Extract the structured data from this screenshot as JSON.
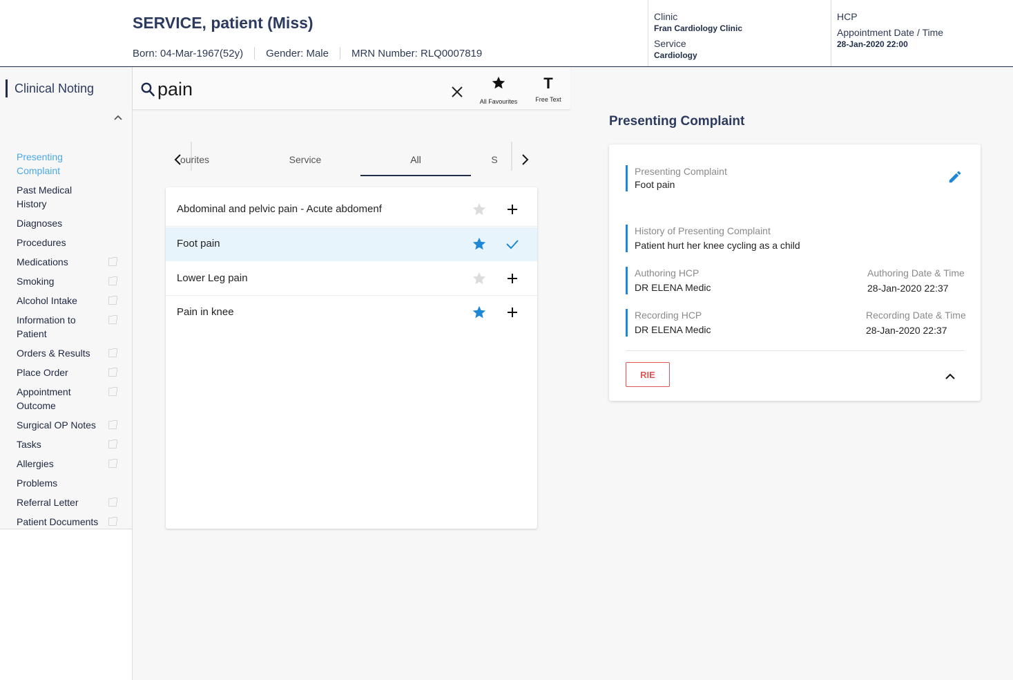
{
  "header": {
    "patient_name": "SERVICE, patient (Miss)",
    "born": "Born: 04-Mar-1967(52y)",
    "gender": "Gender: Male",
    "mrn": "MRN Number: RLQ0007819",
    "clinic_label": "Clinic",
    "clinic_value": "Fran Cardiology Clinic",
    "service_label": "Service",
    "service_value": "Cardiology",
    "hcp_label": "HCP",
    "appt_label": "Appointment Date / Time",
    "appt_value": "28-Jan-2020 22:00"
  },
  "sidebar": {
    "title": "Clinical Noting",
    "items": [
      {
        "label": "Presenting Complaint",
        "ext": false,
        "active": true
      },
      {
        "label": "Past Medical History",
        "ext": false
      },
      {
        "label": "Diagnoses",
        "ext": false
      },
      {
        "label": "Procedures",
        "ext": false
      },
      {
        "label": "Medications",
        "ext": true
      },
      {
        "label": "Smoking",
        "ext": true
      },
      {
        "label": "Alcohol Intake",
        "ext": true
      },
      {
        "label": "Information to Patient",
        "ext": true
      },
      {
        "label": "Orders & Results",
        "ext": true
      },
      {
        "label": "Place Order",
        "ext": true
      },
      {
        "label": "Appointment Outcome",
        "ext": true
      },
      {
        "label": "Surgical OP Notes",
        "ext": true
      },
      {
        "label": "Tasks",
        "ext": true
      },
      {
        "label": "Allergies",
        "ext": true
      },
      {
        "label": "Problems",
        "ext": false
      },
      {
        "label": "Referral Letter",
        "ext": true
      },
      {
        "label": "Patient Documents",
        "ext": true
      }
    ]
  },
  "search": {
    "value": "pain",
    "all_favourites_label": "All Favourites",
    "free_text_label": "Free Text",
    "free_text_glyph": "T"
  },
  "tabs": {
    "items": [
      "ourites",
      "Service",
      "All",
      "S"
    ],
    "active": "All"
  },
  "results": [
    {
      "label": "Abdominal and pelvic pain - Acute abdomenf",
      "favourite": false,
      "selected": false
    },
    {
      "label": "Foot pain",
      "favourite": true,
      "selected": true
    },
    {
      "label": "Lower Leg pain",
      "favourite": false,
      "selected": false
    },
    {
      "label": "Pain in knee",
      "favourite": true,
      "selected": false
    }
  ],
  "panel": {
    "title": "Presenting Complaint",
    "presenting_label": "Presenting Complaint",
    "presenting_value": "Foot pain",
    "history_label": "History of Presenting Complaint",
    "history_value": "Patient hurt her knee cycling as a child",
    "authoring_hcp_label": "Authoring HCP",
    "authoring_hcp_value": "DR ELENA Medic",
    "authoring_dt_label": "Authoring Date & Time",
    "authoring_dt_value": "28-Jan-2020 22:37",
    "recording_hcp_label": "Recording HCP",
    "recording_hcp_value": "DR ELENA Medic",
    "recording_dt_label": "Recording Date & Time",
    "recording_dt_value": "28-Jan-2020 22:37",
    "rie_label": "RIE"
  },
  "colors": {
    "accent_blue": "#1e88d6",
    "active_link": "#4aa8e8",
    "navy": "#2b3a5e",
    "rie_red": "#e05454",
    "selected_row": "#e8f4fc"
  }
}
